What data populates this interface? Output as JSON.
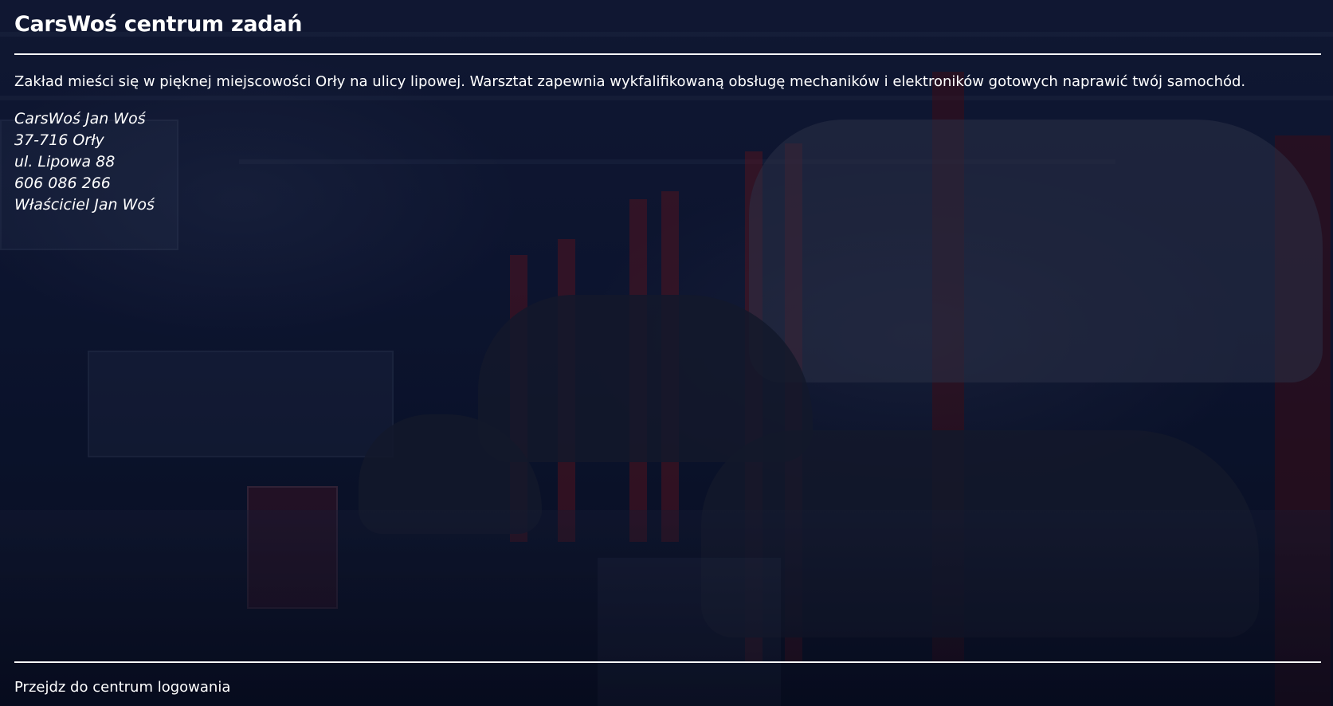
{
  "header": {
    "title": "CarsWoś centrum zadań"
  },
  "main": {
    "intro": "Zakład mieści się w pięknej miejscowości Orły na ulicy lipowej. Warsztat zapewnia wykfalifikowaną obsługę mechaników i elektroników gotowych naprawić twój samochód.",
    "address_lines": [
      "CarsWoś Jan Woś",
      "37-716 Orły",
      "ul. Lipowa 88",
      "606 086 266",
      "Właściciel Jan Woś"
    ]
  },
  "footer": {
    "login_link": "Przejdz do centrum logowania"
  },
  "colors": {
    "text": "#ffffff",
    "background_tint": "#0a1128",
    "rule": "#ffffff"
  }
}
